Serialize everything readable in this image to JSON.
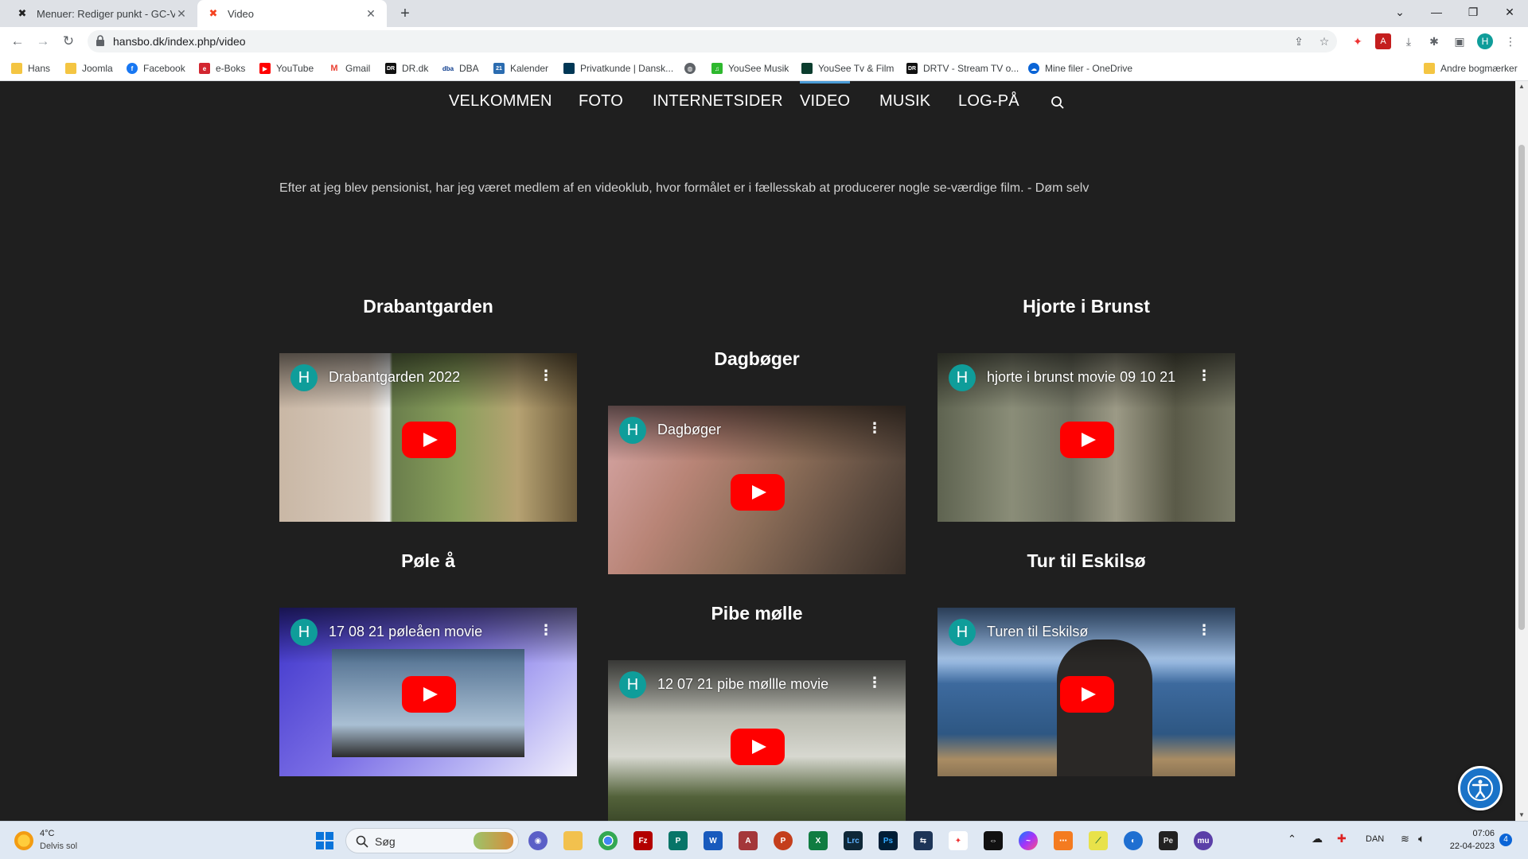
{
  "browser": {
    "tabs": [
      {
        "title": "Menuer: Rediger punkt - GC-Vide",
        "active": false
      },
      {
        "title": "Video",
        "active": true
      }
    ],
    "url": "hansbo.dk/index.php/video",
    "profile_initial": "H",
    "bookmarks": [
      {
        "label": "Hans",
        "icon": "folder-icon",
        "color": "#f4c542"
      },
      {
        "label": "Joomla",
        "icon": "folder-icon",
        "color": "#f4c542"
      },
      {
        "label": "Facebook",
        "icon": "facebook-icon",
        "color": "#1877f2"
      },
      {
        "label": "e-Boks",
        "icon": "eboks-icon",
        "color": "#d22630"
      },
      {
        "label": "YouTube",
        "icon": "youtube-icon",
        "color": "#ff0000"
      },
      {
        "label": "Gmail",
        "icon": "gmail-icon",
        "color": "#ea4335"
      },
      {
        "label": "DR.dk",
        "icon": "dr-icon",
        "color": "#111111"
      },
      {
        "label": "DBA",
        "icon": "dba-icon",
        "color": "#ffffff"
      },
      {
        "label": "Kalender",
        "icon": "calendar-icon",
        "color": "#2b6cb0"
      },
      {
        "label": "Privatkunde | Dansk...",
        "icon": "bank-icon",
        "color": "#003755"
      },
      {
        "label": "",
        "icon": "globe-icon",
        "color": "#5f6368"
      },
      {
        "label": "YouSee Musik",
        "icon": "music-icon",
        "color": "#2eb82e"
      },
      {
        "label": "YouSee Tv & Film",
        "icon": "tv-icon",
        "color": "#0b3d2e"
      },
      {
        "label": "DRTV - Stream TV o...",
        "icon": "drtv-icon",
        "color": "#111111"
      },
      {
        "label": "Mine filer - OneDrive",
        "icon": "onedrive-icon",
        "color": "#0a64d6"
      }
    ],
    "other_bookmarks": "Andre bogmærker"
  },
  "site": {
    "menu": [
      {
        "label": "VELKOMMEN",
        "active": false
      },
      {
        "label": "FOTO",
        "active": false
      },
      {
        "label": "INTERNETSIDER",
        "active": false
      },
      {
        "label": "VIDEO",
        "active": true
      },
      {
        "label": "MUSIK",
        "active": false
      },
      {
        "label": "LOG-PÅ",
        "active": false
      }
    ],
    "intro": "Efter at jeg blev pensionist, har jeg været medlem af en videoklub, hvor formålet er i fællesskab at producerer nogle se-værdige film. - Døm selv",
    "videos": [
      {
        "heading": "Drabantgarden",
        "video_title": "Drabantgarden 2022",
        "channel": "H"
      },
      {
        "heading": "Dagbøger",
        "video_title": "Dagbøger",
        "channel": "H"
      },
      {
        "heading": "Hjorte i Brunst",
        "video_title": "hjorte i brunst movie 09 10 21",
        "channel": "H"
      },
      {
        "heading": "Pøle å",
        "video_title": "17 08 21 pøleåen movie",
        "channel": "H"
      },
      {
        "heading": "Pibe mølle",
        "video_title": "12 07 21 pibe møllle movie",
        "channel": "H"
      },
      {
        "heading": "Tur til Eskilsø",
        "video_title": "Turen til Eskilsø",
        "channel": "H"
      }
    ]
  },
  "taskbar": {
    "weather_temp": "4°C",
    "weather_desc": "Delvis sol",
    "search_label": "Søg",
    "language": "DAN",
    "time": "07:06",
    "date": "22-04-2023",
    "notifications": "4"
  }
}
